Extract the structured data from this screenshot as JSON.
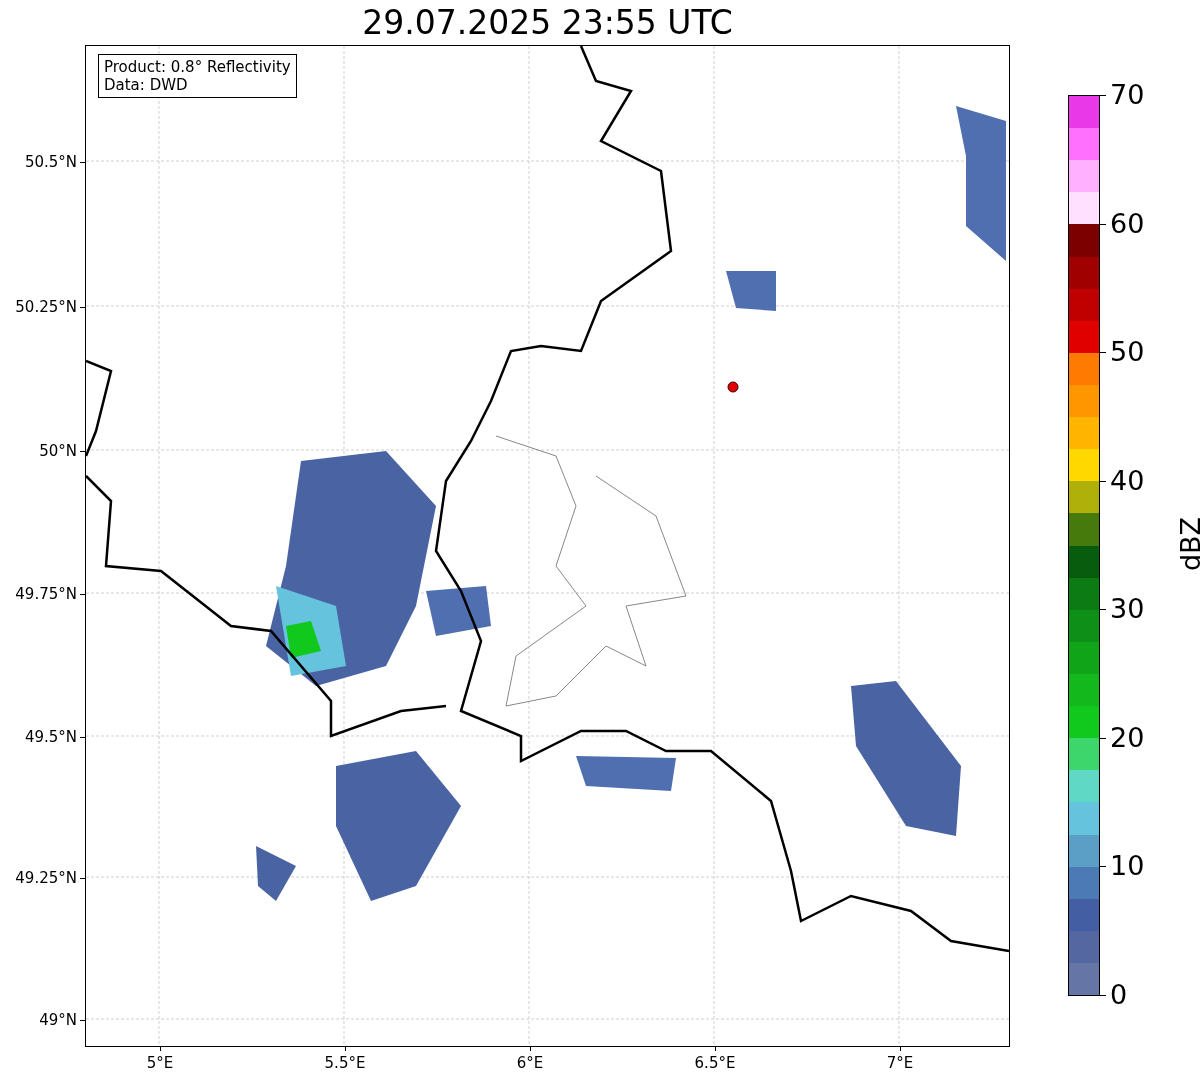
{
  "title": "29.07.2025 23:55 UTC",
  "info_box": {
    "lines": [
      "Product: 0.8° Reflectivity",
      "Data: DWD"
    ]
  },
  "map": {
    "x_ticks": [
      "5°E",
      "5.5°E",
      "6°E",
      "6.5°E",
      "7°E"
    ],
    "y_ticks": [
      "50.5°N",
      "50.25°N",
      "50°N",
      "49.75°N",
      "49.5°N",
      "49.25°N",
      "49°N"
    ]
  },
  "colorbar": {
    "label": "dBZ",
    "ticks": [
      "70",
      "60",
      "50",
      "40",
      "30",
      "20",
      "10",
      "0"
    ],
    "bins": [
      {
        "color": "#e838e8"
      },
      {
        "color": "#ff70ff"
      },
      {
        "color": "#ffb0ff"
      },
      {
        "color": "#ffe0ff"
      },
      {
        "color": "#7c0000"
      },
      {
        "color": "#a00000"
      },
      {
        "color": "#c00000"
      },
      {
        "color": "#e00000"
      },
      {
        "color": "#ff7a00"
      },
      {
        "color": "#ff9600"
      },
      {
        "color": "#ffb400"
      },
      {
        "color": "#ffd800"
      },
      {
        "color": "#b0b00a"
      },
      {
        "color": "#477a0c"
      },
      {
        "color": "#075c0e"
      },
      {
        "color": "#0c7b14"
      },
      {
        "color": "#0e9018"
      },
      {
        "color": "#10a518"
      },
      {
        "color": "#12b81c"
      },
      {
        "color": "#10c91c"
      },
      {
        "color": "#3dd66c"
      },
      {
        "color": "#5fd8c5"
      },
      {
        "color": "#66c3dd"
      },
      {
        "color": "#5b9fc7"
      },
      {
        "color": "#4b7ab4"
      },
      {
        "color": "#435ea3"
      },
      {
        "color": "#5467a0"
      },
      {
        "color": "#6475a6"
      }
    ]
  }
}
